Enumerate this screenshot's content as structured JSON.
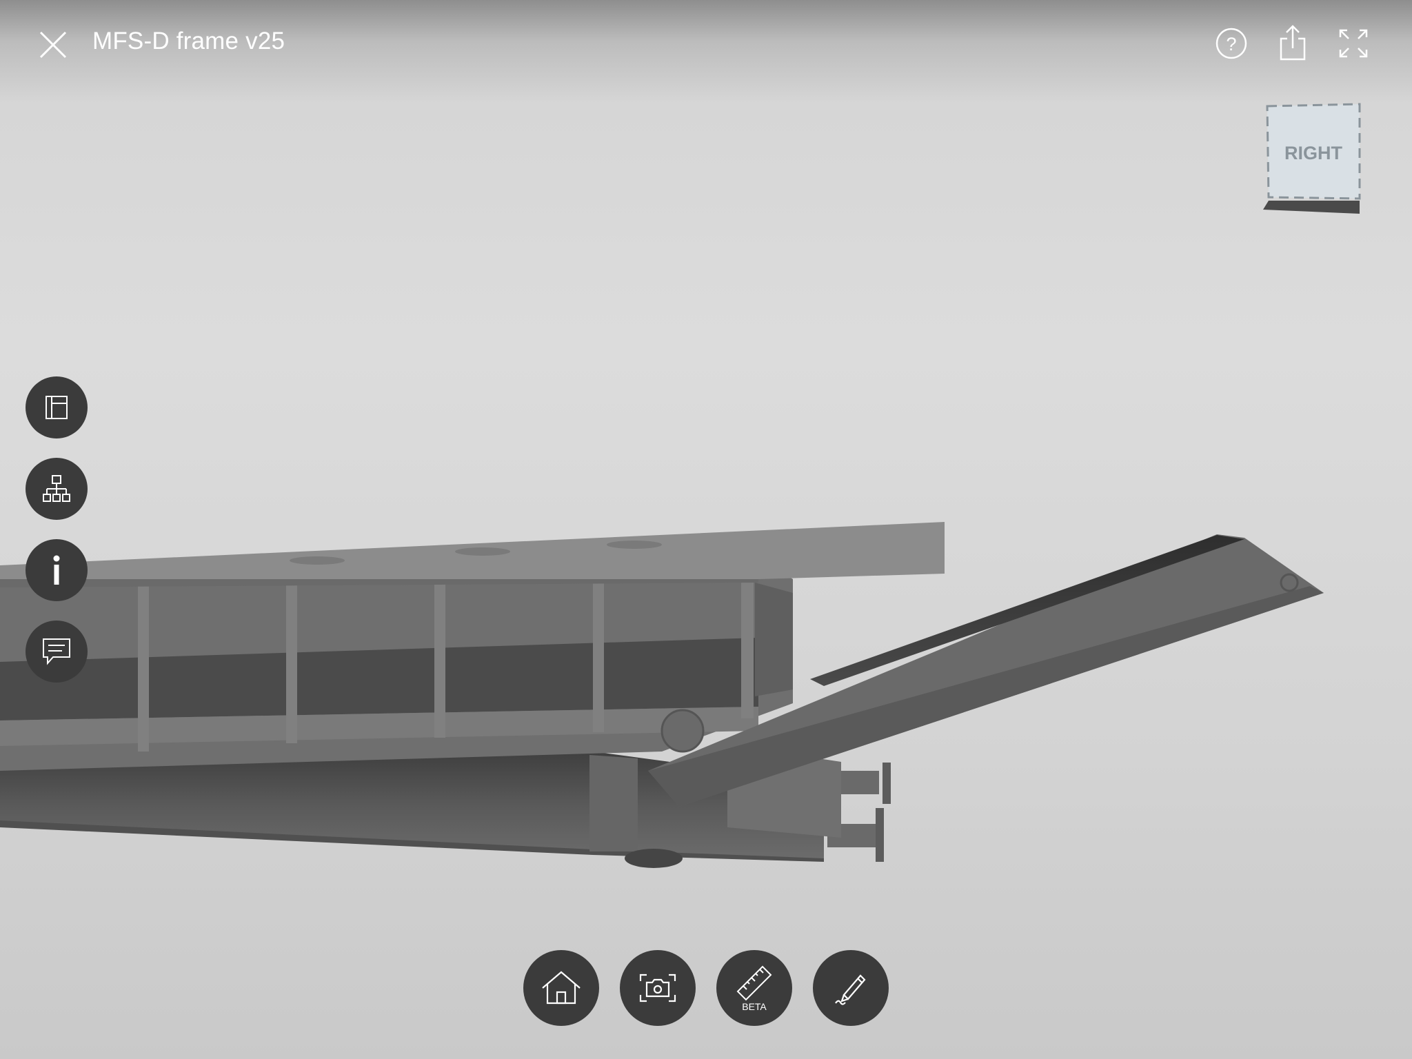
{
  "header": {
    "title": "MFS-D frame v25",
    "close_icon": "close-icon",
    "help_icon": "help-icon",
    "share_icon": "share-icon",
    "fullscreen_icon": "fullscreen-icon"
  },
  "viewcube": {
    "face_label": "RIGHT"
  },
  "side_toolbar": {
    "items": [
      {
        "name": "model-browser-button",
        "icon": "panel-layout-icon"
      },
      {
        "name": "structure-tree-button",
        "icon": "hierarchy-icon"
      },
      {
        "name": "info-button",
        "icon": "info-icon"
      },
      {
        "name": "comments-button",
        "icon": "comment-icon"
      }
    ]
  },
  "bottom_toolbar": {
    "items": [
      {
        "name": "home-view-button",
        "icon": "home-icon"
      },
      {
        "name": "snapshot-button",
        "icon": "camera-icon"
      },
      {
        "name": "measure-button",
        "icon": "ruler-icon",
        "badge": "BETA"
      },
      {
        "name": "markup-button",
        "icon": "pencil-icon"
      }
    ]
  },
  "colors": {
    "button_bg": "#3b3b3b",
    "model_gray": "#6e6e6e",
    "viewcube_face": "#d9e0e5",
    "viewcube_label": "#8a949b"
  }
}
